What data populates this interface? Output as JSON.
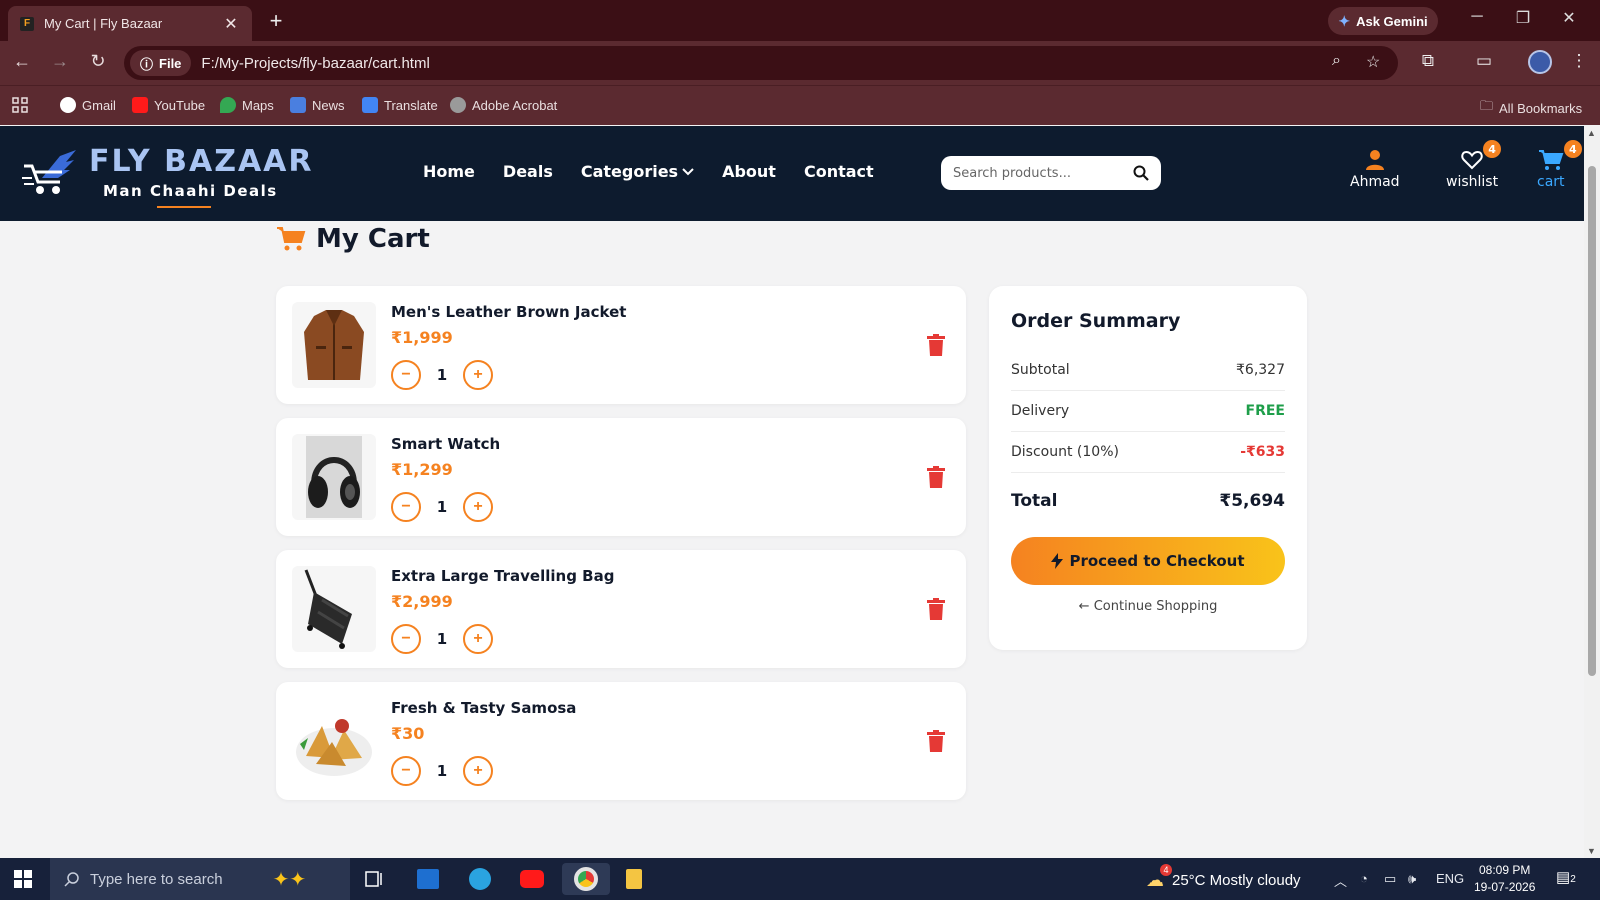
{
  "browser": {
    "tab_title": "My Cart | Fly Bazaar",
    "tab_favicon": "F",
    "gemini_label": "Ask Gemini",
    "file_chip": "File",
    "url": "F:/My-Projects/fly-bazaar/cart.html",
    "bookmarks": [
      "Gmail",
      "YouTube",
      "Maps",
      "News",
      "Translate",
      "Adobe Acrobat"
    ],
    "all_bookmarks": "All Bookmarks"
  },
  "header": {
    "logo_title": "FLY BAZAAR",
    "logo_subtitle": "Man Chaahi Deals",
    "nav": [
      "Home",
      "Deals",
      "Categories",
      "About",
      "Contact"
    ],
    "search_placeholder": "Search products...",
    "user_label": "Ahmad",
    "wishlist_label": "wishlist",
    "wishlist_count": "4",
    "cart_label": "cart",
    "cart_count": "4"
  },
  "page": {
    "title": "My Cart"
  },
  "cart": {
    "items": [
      {
        "name": "Men's Leather Brown Jacket",
        "price": "₹1,999",
        "qty": "1",
        "image": "jacket"
      },
      {
        "name": "Smart Watch",
        "price": "₹1,299",
        "qty": "1",
        "image": "headphones"
      },
      {
        "name": "Extra Large Travelling Bag",
        "price": "₹2,999",
        "qty": "1",
        "image": "bag"
      },
      {
        "name": "Fresh & Tasty Samosa",
        "price": "₹30",
        "qty": "1",
        "image": "samosa"
      }
    ]
  },
  "summary": {
    "title": "Order Summary",
    "subtotal_label": "Subtotal",
    "subtotal_value": "₹6,327",
    "delivery_label": "Delivery",
    "delivery_value": "FREE",
    "discount_label": "Discount (10%)",
    "discount_value": "-₹633",
    "total_label": "Total",
    "total_value": "₹5,694",
    "checkout_label": "Proceed to Checkout",
    "continue_label": "Continue Shopping"
  },
  "colors": {
    "accent": "#f58220",
    "header_bg": "#0d1b2e",
    "free_green": "#1e9e4a",
    "discount_red": "#e53935"
  },
  "taskbar": {
    "search_placeholder": "Type here to search",
    "weather": "25°C  Mostly cloudy",
    "weather_badge": "4",
    "lang": "ENG",
    "time": "08:09 PM",
    "date": "19-07-2026",
    "notif_count": "2"
  }
}
